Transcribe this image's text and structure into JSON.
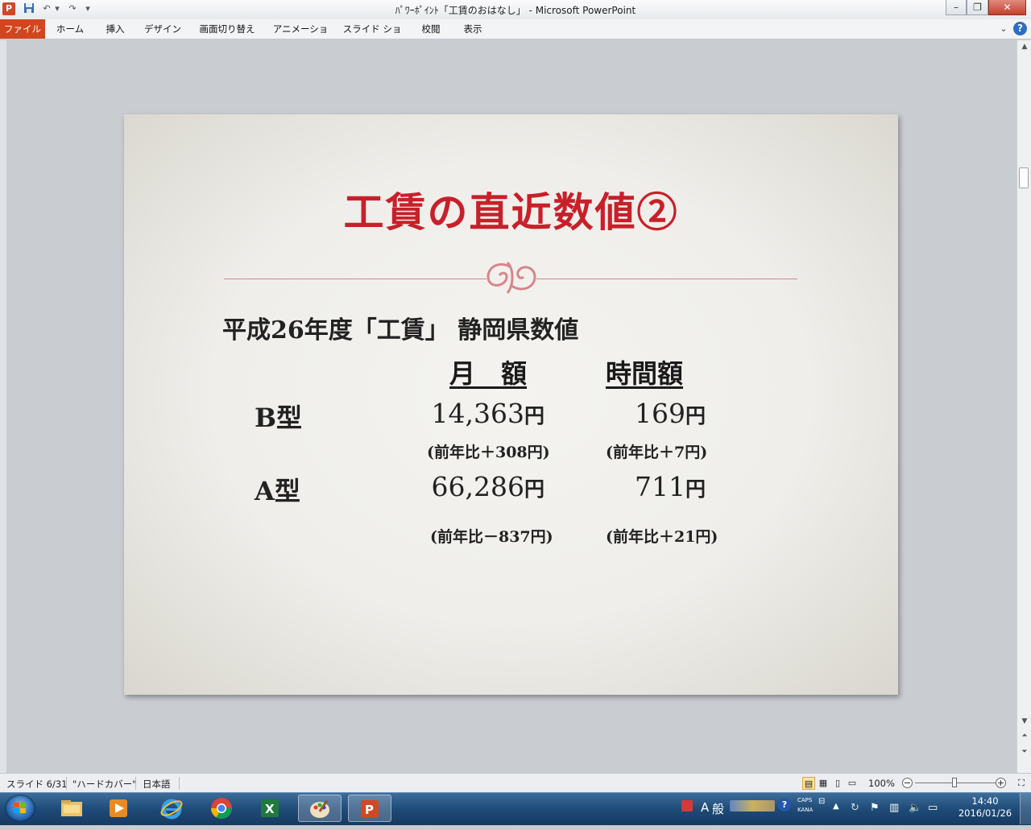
{
  "window": {
    "title": "ﾊﾟﾜｰﾎﾟｲﾝﾄ「工賃のおはなし」 - Microsoft PowerPoint",
    "app_icon": "P",
    "controls": {
      "minimize": "–",
      "restore": "❐",
      "close": "✕"
    }
  },
  "qat": {
    "save_icon": "floppy",
    "undo": "↶",
    "redo": "↷",
    "more": "▾"
  },
  "ribbon": {
    "tabs": [
      "ファイル",
      "ホーム",
      "挿入",
      "デザイン",
      "画面切り替え",
      "アニメーション",
      "スライド ショー",
      "校閲",
      "表示"
    ],
    "active_tab_color": "#d1461e",
    "minimize_icon": "chevron-down",
    "help": "?"
  },
  "slide": {
    "title": "工賃の直近数値②",
    "subtitle": "平成26年度「工賃」 静岡県数値",
    "col_headers": {
      "monthly": "月　額",
      "hourly": "時間額"
    },
    "rows": [
      {
        "label": "B型",
        "monthly": "14,363",
        "monthly_unit": "円",
        "hourly": "169",
        "hourly_unit": "円",
        "monthly_change": "(前年比＋308円)",
        "hourly_change": "(前年比＋7円)"
      },
      {
        "label": "A型",
        "monthly": "66,286",
        "monthly_unit": "円",
        "hourly": "711",
        "hourly_unit": "円",
        "monthly_change": "(前年比－837円)",
        "hourly_change": "(前年比＋21円)"
      }
    ],
    "title_color": "#c8202a",
    "ornament_color": "#d9848a"
  },
  "status": {
    "slide_info": "スライド 6/31",
    "theme": "\"ハードカバー\"",
    "language": "日本語",
    "zoom": "100%",
    "zoom_minus": "−",
    "zoom_plus": "+"
  },
  "taskbar": {
    "ime_a": "A",
    "ime_mode": "般",
    "caps": "CAPS",
    "kana": "KANA",
    "time": "14:40",
    "date": "2016/01/26"
  }
}
